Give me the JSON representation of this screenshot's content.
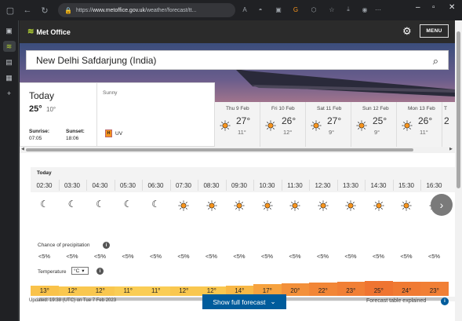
{
  "browser": {
    "url_prefix": "https://",
    "url_domain": "www.metoffice.gov.uk",
    "url_path": "/weather/forecast/tt..."
  },
  "header": {
    "logo": "Met Office",
    "menu_label": "MENU"
  },
  "search": {
    "value": "New Delhi Safdarjung (India)"
  },
  "today": {
    "title": "Today",
    "max": "25°",
    "min": "10°",
    "sunrise_label": "Sunrise:",
    "sunrise": "07:05",
    "sunset_label": "Sunset:",
    "sunset": "18:06",
    "weather": "Sunny",
    "uv_level": "H",
    "uv_label": "UV"
  },
  "days": [
    {
      "label": "Thu 9 Feb",
      "max": "27°",
      "min": "11°"
    },
    {
      "label": "Fri 10 Feb",
      "max": "26°",
      "min": "12°"
    },
    {
      "label": "Sat 11 Feb",
      "max": "27°",
      "min": "9°"
    },
    {
      "label": "Sun 12 Feb",
      "max": "25°",
      "min": "9°"
    },
    {
      "label": "Mon 13 Feb",
      "max": "26°",
      "min": "11°"
    },
    {
      "label": "T",
      "max": "2",
      "min": ""
    }
  ],
  "hourly": {
    "day_label": "Today",
    "times": [
      "02:30",
      "03:30",
      "04:30",
      "05:30",
      "06:30",
      "07:30",
      "08:30",
      "09:30",
      "10:30",
      "11:30",
      "12:30",
      "13:30",
      "14:30",
      "15:30",
      "16:30"
    ],
    "icons": [
      "moon-icon",
      "moon-icon",
      "moon-icon",
      "moon-icon",
      "moon-icon",
      "sun-icon",
      "sun-icon",
      "sun-icon",
      "sun-icon",
      "sun-icon",
      "sun-icon",
      "sun-icon",
      "sun-icon",
      "sun-icon",
      "sun-icon"
    ],
    "precip_label": "Chance of precipitation",
    "precip": [
      "<5%",
      "<5%",
      "<5%",
      "<5%",
      "<5%",
      "<5%",
      "<5%",
      "<5%",
      "<5%",
      "<5%",
      "<5%",
      "<5%",
      "<5%",
      "<5%",
      "<5%"
    ],
    "temp_label": "Temperature",
    "unit": "°C",
    "temps": [
      "13°",
      "12°",
      "12°",
      "11°",
      "11°",
      "12°",
      "12°",
      "14°",
      "17°",
      "20°",
      "22°",
      "23°",
      "25°",
      "24°",
      "23°"
    ],
    "temp_colors": [
      "#f9c24a",
      "#f9c74f",
      "#f9c74f",
      "#facd55",
      "#facd55",
      "#f9c74f",
      "#f9c74f",
      "#f8b846",
      "#f6a23f",
      "#f3903a",
      "#f28637",
      "#f17f35",
      "#ef7431",
      "#f07a33",
      "#f17f35"
    ]
  },
  "footer": {
    "updated": "Updated: 19:38 (UTC) on Tue 7 Feb 2023",
    "full_forecast": "Show full forecast",
    "explained": "Forecast table explained"
  },
  "colors": {
    "accent": "#005c9c",
    "brand_green": "#b3d334",
    "sun": "#f7941d"
  }
}
